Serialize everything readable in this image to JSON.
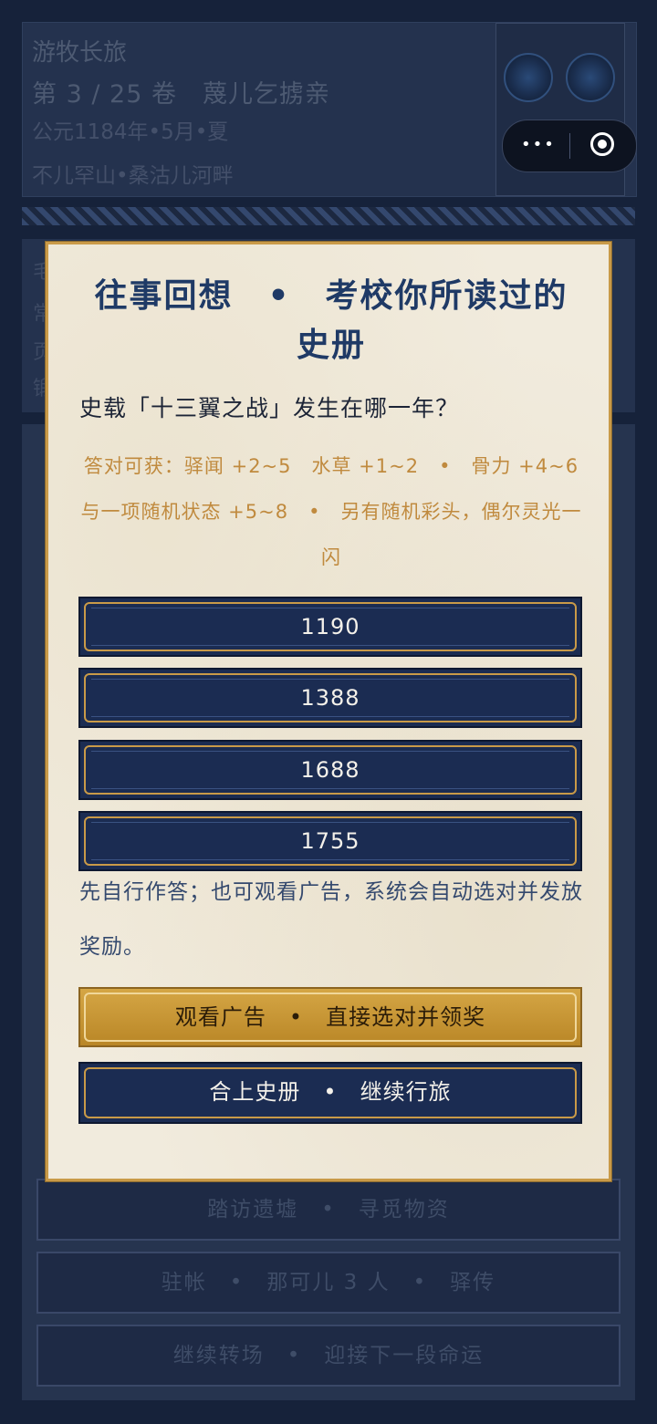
{
  "background": {
    "header": {
      "app_title": "游牧长旅",
      "chapter": "第 3 / 25 卷　蔑儿乞掳亲",
      "date": "公元1184年•5月•夏",
      "location": "不儿罕山•桑沽儿河畔"
    },
    "panel_lines": [
      "毛",
      "常",
      "页",
      "锻"
    ],
    "buttons": {
      "explore": "踏访遗墟　•　寻觅物资",
      "camp": "驻帐　•　那可儿 3 人　•　驿传",
      "next_scene": "继续转场　•　迎接下一段命运"
    },
    "capsule": {
      "more": "•••"
    }
  },
  "modal": {
    "title": "往事回想　•　考校你所读过的史册",
    "question": "史载「十三翼之战」发生在哪一年？",
    "reward": "答对可获：驿闻 +2~5　水草 +1~2　•　骨力 +4~6 与一项随机状态 +5~8　•　另有随机彩头，偶尔灵光一闪",
    "options": [
      "1190",
      "1388",
      "1688",
      "1755"
    ],
    "hint": "先自行作答；也可观看广告，系统会自动选对并发放奖励。",
    "watch_ad_label": "观看广告　•　直接选对并领奖",
    "close_label": "合上史册　•　继续行旅"
  },
  "colors": {
    "accent_gold": "#c99a48",
    "navy": "#1b2c52",
    "title_blue": "#1f3a66",
    "reward_text": "#c08a3e"
  }
}
